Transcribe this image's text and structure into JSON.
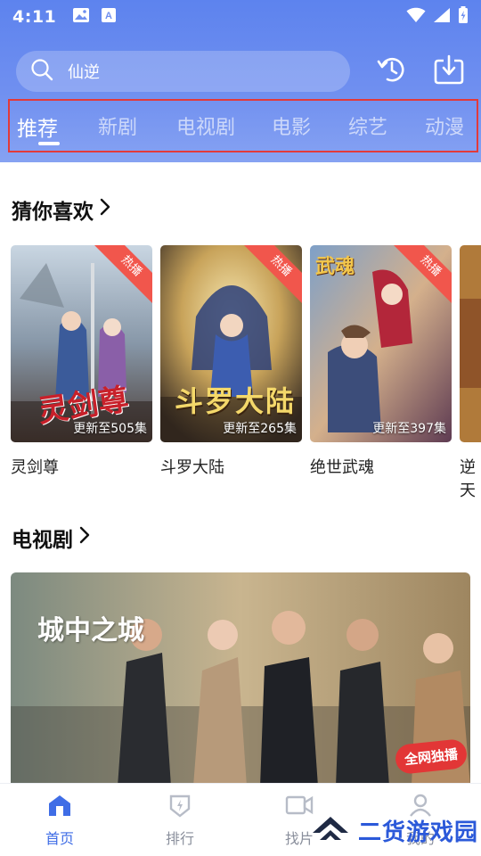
{
  "status_bar": {
    "time": "4:11",
    "icons": [
      "image-icon",
      "text-a-icon",
      "wifi-icon",
      "signal-icon",
      "battery-charging-icon"
    ]
  },
  "search": {
    "value": "仙逆",
    "icon": "search-icon"
  },
  "header_actions": [
    {
      "name": "history-icon"
    },
    {
      "name": "download-icon"
    }
  ],
  "tabs": [
    {
      "label": "推荐",
      "active": true
    },
    {
      "label": "新剧",
      "active": false
    },
    {
      "label": "电视剧",
      "active": false
    },
    {
      "label": "电影",
      "active": false
    },
    {
      "label": "综艺",
      "active": false
    },
    {
      "label": "动漫",
      "active": false
    }
  ],
  "guess_section": {
    "title": "猜你喜欢",
    "cards": [
      {
        "title": "灵剑尊",
        "badge": "热播",
        "episodes": "更新至505集",
        "poster_text": "灵剑尊"
      },
      {
        "title": "斗罗大陆",
        "badge": "热播",
        "episodes": "更新至265集",
        "poster_text": "斗罗大陆"
      },
      {
        "title": "绝世武魂",
        "badge": "热播",
        "episodes": "更新至397集",
        "poster_text": "武魂"
      },
      {
        "title": "逆天",
        "badge": "",
        "episodes": "",
        "poster_text": ""
      }
    ]
  },
  "tv_section": {
    "title": "电视剧",
    "banner": {
      "title_art": "城中之城",
      "badge": "全网独播"
    }
  },
  "bottom_nav": [
    {
      "label": "首页",
      "icon": "home-icon",
      "active": true
    },
    {
      "label": "排行",
      "icon": "ranking-icon",
      "active": false
    },
    {
      "label": "找片",
      "icon": "video-find-icon",
      "active": false
    },
    {
      "label": "我的",
      "icon": "profile-icon",
      "active": false
    }
  ],
  "watermark": {
    "text": "二货游戏园"
  },
  "colors": {
    "header_gradient_top": "#5d83ee",
    "header_gradient_bottom": "#86a2f2",
    "tab_highlight_border": "#e23a3a",
    "badge_red": "#f1564c",
    "nav_active": "#3f6de6",
    "nav_inactive": "#8a8f9c"
  }
}
